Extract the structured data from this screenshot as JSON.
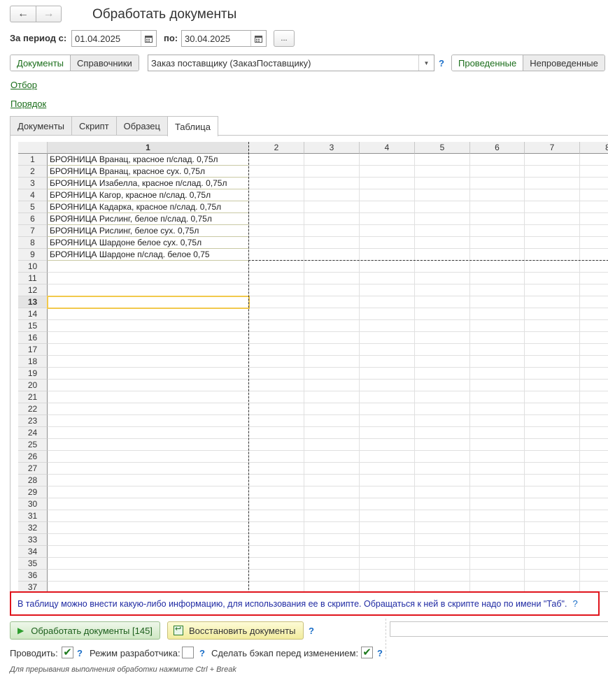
{
  "window": {
    "title": "Обработать документы"
  },
  "nav": {
    "back_icon": "arrow-left-icon",
    "forward_icon": "arrow-right-icon"
  },
  "period": {
    "from_label": "За период с:",
    "from_value": "01.04.2025",
    "to_label": "по:",
    "to_value": "30.04.2025",
    "more_label": "..."
  },
  "type_switch": {
    "documents": "Документы",
    "references": "Справочники"
  },
  "object_select": {
    "value": "Заказ поставщику (ЗаказПоставщику)"
  },
  "help_mark": "?",
  "posted_switch": {
    "posted": "Проведенные",
    "unposted": "Непроведенные"
  },
  "links": {
    "filter": "Отбор",
    "order": "Порядок"
  },
  "tabs": [
    "Документы",
    "Скрипт",
    "Образец",
    "Таблица"
  ],
  "active_tab": "Таблица",
  "spreadsheet": {
    "columns": [
      "1",
      "2",
      "3",
      "4",
      "5",
      "6",
      "7",
      "8"
    ],
    "selected_row": 13,
    "visible_rows": 37,
    "rows": [
      "БРОЯНИЦА Вранац, красное п/слад. 0,75л",
      "БРОЯНИЦА Вранац, красное сух. 0,75л",
      "БРОЯНИЦА Изабелла, красное п/слад. 0,75л",
      "БРОЯНИЦА Кагор, красное п/слад. 0,75л",
      "БРОЯНИЦА Кадарка, красное п/слад. 0,75л",
      "БРОЯНИЦА Рислинг, белое п/слад. 0,75л",
      "БРОЯНИЦА Рислинг, белое сух. 0,75л",
      "БРОЯНИЦА Шардоне белое сух. 0,75л",
      "БРОЯНИЦА Шардоне п/слад. белое 0,75"
    ]
  },
  "info_text": "В таблицу можно внести какую-либо информацию, для использования ее в скрипте. Обращаться к ней в скрипте надо по имени \"Таб\".",
  "actions": {
    "process_label": "Обработать документы [145]",
    "restore_label": "Восстановить документы"
  },
  "options": {
    "post_label": "Проводить:",
    "post_checked": true,
    "dev_label": "Режим разработчика:",
    "dev_checked": false,
    "backup_label": "Сделать бэкап перед изменением:",
    "backup_checked": true
  },
  "footer_hint": "Для прерывания выполнения обработки нажмите Ctrl + Break",
  "colors": {
    "accent_green": "#1b6e1b",
    "help_blue": "#1a6ec8",
    "alert_red": "#e0141c",
    "info_text": "#1f2aa3"
  }
}
